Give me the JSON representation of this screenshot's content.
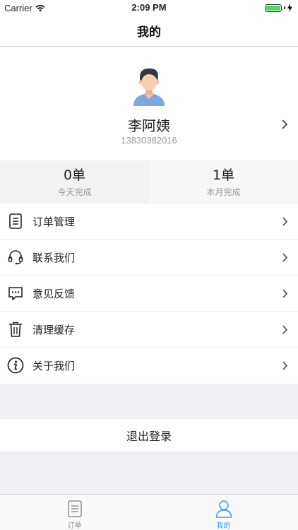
{
  "status_bar": {
    "carrier": "Carrier",
    "time": "2:09 PM"
  },
  "nav": {
    "title": "我的"
  },
  "profile": {
    "name": "李阿姨",
    "phone": "13830382016"
  },
  "stats": [
    {
      "value": "0单",
      "label": "今天完成"
    },
    {
      "value": "1单",
      "label": "本月完成"
    }
  ],
  "menu": {
    "items": [
      {
        "label": "订单管理",
        "icon": "document-icon"
      },
      {
        "label": "联系我们",
        "icon": "headset-icon"
      },
      {
        "label": "意见反馈",
        "icon": "chat-bubble-icon"
      },
      {
        "label": "清理缓存",
        "icon": "trash-icon"
      },
      {
        "label": "关于我们",
        "icon": "info-icon"
      }
    ]
  },
  "logout": {
    "label": "退出登录"
  },
  "tabs": [
    {
      "label": "订单",
      "icon": "document-icon",
      "active": false
    },
    {
      "label": "我的",
      "icon": "person-icon",
      "active": true
    }
  ],
  "colors": {
    "accent": "#3d9be9",
    "battery": "#4cd964",
    "background": "#efeff4"
  }
}
